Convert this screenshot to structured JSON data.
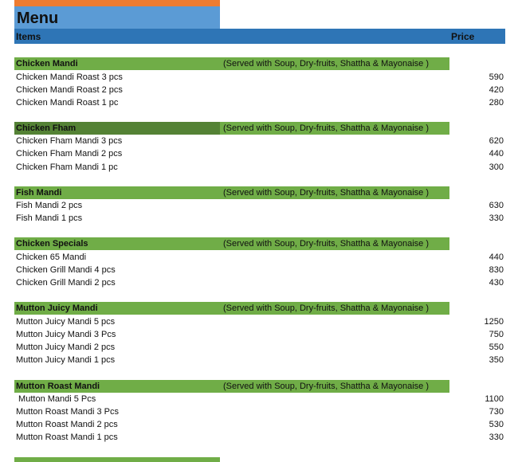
{
  "banner": {
    "title": ""
  },
  "menu": {
    "title": "Menu"
  },
  "columns": {
    "items": "Items",
    "price": "Price"
  },
  "categories": [
    {
      "name": "Chicken Mandi",
      "note": "(Served with Soup, Dry-fruits, Shattha & Mayonaise )",
      "items": [
        {
          "name": "Chicken Mandi Roast 3 pcs",
          "price": "590"
        },
        {
          "name": "Chicken Mandi Roast 2 pcs",
          "price": "420"
        },
        {
          "name": "Chicken Mandi Roast 1 pc",
          "price": "280"
        }
      ]
    },
    {
      "name": "Chicken Fham",
      "note": "(Served with Soup, Dry-fruits, Shattha & Mayonaise )",
      "items": [
        {
          "name": "Chicken Fham Mandi 3 pcs",
          "price": "620"
        },
        {
          "name": "Chicken Fham Mandi 2 pcs",
          "price": "440"
        },
        {
          "name": "Chicken Fham Mandi 1 pc",
          "price": "300"
        }
      ]
    },
    {
      "name": "Fish Mandi",
      "note": "(Served with Soup, Dry-fruits, Shattha & Mayonaise )",
      "items": [
        {
          "name": "Fish Mandi 2 pcs",
          "price": "630"
        },
        {
          "name": "Fish Mandi 1 pcs",
          "price": "330"
        }
      ]
    },
    {
      "name": "Chicken Specials",
      "note": "(Served with Soup, Dry-fruits, Shattha & Mayonaise )",
      "items": [
        {
          "name": "Chicken 65 Mandi",
          "price": "440"
        },
        {
          "name": "Chicken Grill Mandi 4 pcs",
          "price": "830"
        },
        {
          "name": "Chicken Grill Mandi 2 pcs",
          "price": "430"
        }
      ]
    },
    {
      "name": "Mutton Juicy Mandi",
      "note": "(Served with Soup, Dry-fruits, Shattha & Mayonaise )",
      "items": [
        {
          "name": "Mutton Juicy Mandi 5 pcs",
          "price": "1250"
        },
        {
          "name": "Mutton Juicy Mandi 3 Pcs",
          "price": "750"
        },
        {
          "name": "Mutton Juicy Mandi 2 pcs",
          "price": "550"
        },
        {
          "name": "Mutton Juicy Mandi 1 pcs",
          "price": "350"
        }
      ]
    },
    {
      "name": "Mutton Roast Mandi",
      "note": "(Served with Soup, Dry-fruits, Shattha & Mayonaise )",
      "items": [
        {
          "name": " Mutton Mandi 5 Pcs",
          "price": "1100"
        },
        {
          "name": "Mutton Roast Mandi 3 Pcs",
          "price": "730"
        },
        {
          "name": "Mutton Roast Mandi 2 pcs",
          "price": "530"
        },
        {
          "name": "Mutton Roast Mandi 1 pcs",
          "price": "330"
        }
      ]
    }
  ],
  "colors": {
    "banner_orange": "#ee7c31",
    "title_blue": "#5b9bd5",
    "header_blue": "#2e75b6",
    "category_green": "#70ad47",
    "category_dark_green": "#548235"
  }
}
